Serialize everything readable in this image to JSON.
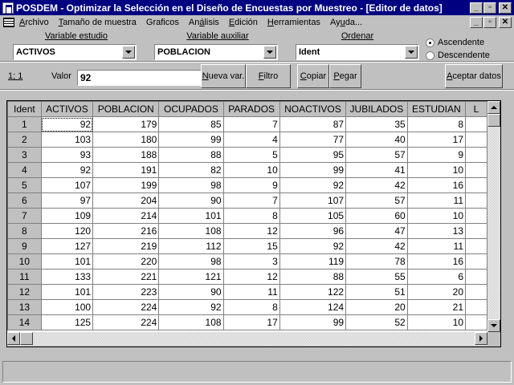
{
  "window": {
    "title": "POSDEM - Optimizar la Selección en el Diseño de Encuestas por Muestreo  - [Editor de datos]"
  },
  "menu": {
    "items": [
      {
        "pre": "",
        "key": "A",
        "post": "rchivo"
      },
      {
        "pre": "",
        "key": "T",
        "post": "amaño de muestra"
      },
      {
        "pre": "",
        "key": "",
        "post": "Graficos"
      },
      {
        "pre": "An",
        "key": "á",
        "post": "lisis"
      },
      {
        "pre": "",
        "key": "E",
        "post": "dición"
      },
      {
        "pre": "",
        "key": "H",
        "post": "erramientas"
      },
      {
        "pre": "Ay",
        "key": "u",
        "post": "da..."
      }
    ]
  },
  "panel": {
    "variable_estudio": {
      "label": "Variable estudio",
      "value": "ACTIVOS"
    },
    "variable_auxiliar": {
      "label": "Variable auxiliar",
      "value": "POBLACION"
    },
    "ordenar": {
      "label": "Ordenar",
      "value": "Ident"
    },
    "sort": {
      "ascendente": "Ascendente",
      "descendente": "Descendente",
      "selected": "ascendente"
    },
    "position_label": "1; 1",
    "valor_label": "Valor",
    "valor_value": "92",
    "buttons": {
      "nueva_var": {
        "pre": "",
        "key": "N",
        "post": "ueva var."
      },
      "filtro": {
        "pre": "",
        "key": "F",
        "post": "iltro"
      },
      "copiar": {
        "pre": "",
        "key": "C",
        "post": "opiar"
      },
      "pegar": {
        "pre": "",
        "key": "P",
        "post": "egar"
      },
      "aceptar": {
        "pre": "",
        "key": "A",
        "post": "ceptar datos"
      }
    }
  },
  "grid": {
    "columns": [
      "Ident",
      "ACTIVOS",
      "POBLACION",
      "OCUPADOS",
      "PARADOS",
      "NOACTIVOS",
      "JUBILADOS",
      "ESTUDIAN",
      "L"
    ],
    "rows": [
      [
        "1",
        "92",
        "179",
        "85",
        "7",
        "87",
        "35",
        "8"
      ],
      [
        "2",
        "103",
        "180",
        "99",
        "4",
        "77",
        "40",
        "17"
      ],
      [
        "3",
        "93",
        "188",
        "88",
        "5",
        "95",
        "57",
        "9"
      ],
      [
        "4",
        "92",
        "191",
        "82",
        "10",
        "99",
        "41",
        "10"
      ],
      [
        "5",
        "107",
        "199",
        "98",
        "9",
        "92",
        "42",
        "16"
      ],
      [
        "6",
        "97",
        "204",
        "90",
        "7",
        "107",
        "57",
        "11"
      ],
      [
        "7",
        "109",
        "214",
        "101",
        "8",
        "105",
        "60",
        "10"
      ],
      [
        "8",
        "120",
        "216",
        "108",
        "12",
        "96",
        "47",
        "13"
      ],
      [
        "9",
        "127",
        "219",
        "112",
        "15",
        "92",
        "42",
        "11"
      ],
      [
        "10",
        "101",
        "220",
        "98",
        "3",
        "119",
        "78",
        "16"
      ],
      [
        "11",
        "133",
        "221",
        "121",
        "12",
        "88",
        "55",
        "6"
      ],
      [
        "12",
        "101",
        "223",
        "90",
        "11",
        "122",
        "51",
        "20"
      ],
      [
        "13",
        "100",
        "224",
        "92",
        "8",
        "124",
        "20",
        "21"
      ],
      [
        "14",
        "125",
        "224",
        "108",
        "17",
        "99",
        "52",
        "10"
      ]
    ]
  }
}
